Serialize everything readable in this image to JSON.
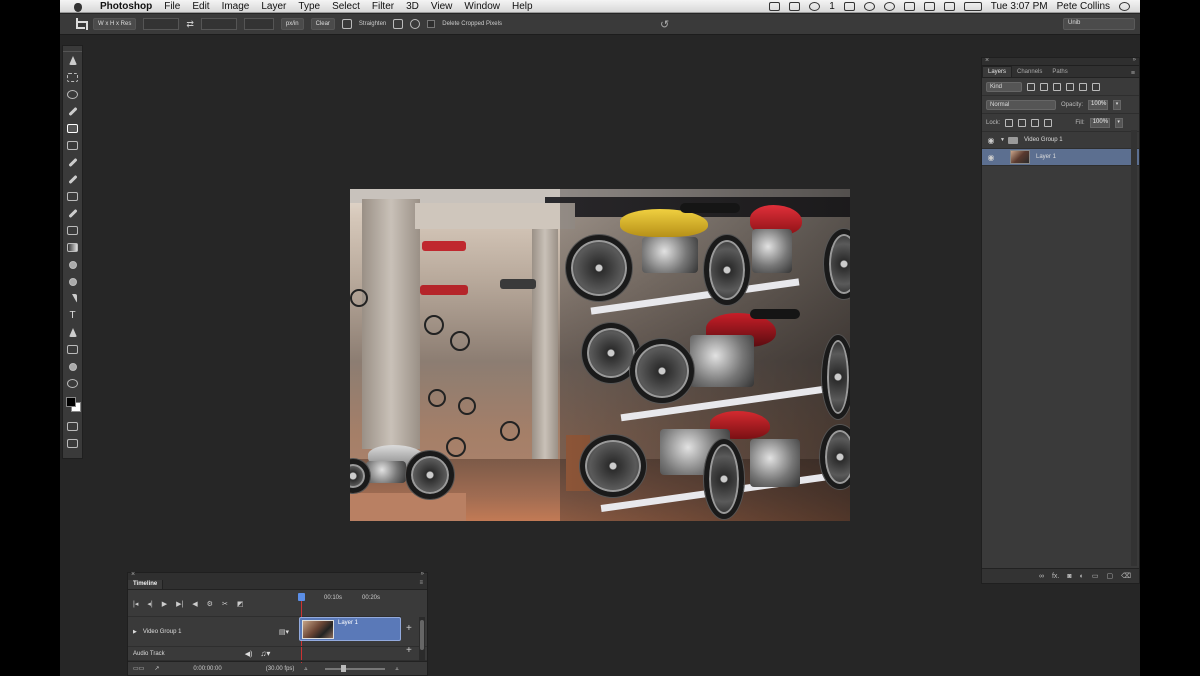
{
  "menubar": {
    "app": "Photoshop",
    "items": [
      "File",
      "Edit",
      "Image",
      "Layer",
      "Type",
      "Select",
      "Filter",
      "3D",
      "View",
      "Window",
      "Help"
    ],
    "status_number": "1",
    "clock": "Tue 3:07 PM",
    "user": "Pete Collins"
  },
  "options": {
    "ratio_preset": "W x H x Res",
    "units": "px/in",
    "clear_label": "Clear",
    "straighten_label": "Straighten",
    "delete_cropped_label": "Delete Cropped Pixels",
    "preset_dropdown": "Unib"
  },
  "layers_panel": {
    "tabs": [
      "Layers",
      "Channels",
      "Paths"
    ],
    "filter_kind": "Kind",
    "blend_mode": "Normal",
    "opacity_label": "Opacity:",
    "opacity_value": "100%",
    "lock_label": "Lock:",
    "fill_label": "Fill:",
    "fill_value": "100%",
    "group_name": "Video Group 1",
    "layer_name": "Layer 1",
    "footer_fx": "fx."
  },
  "timeline": {
    "tab": "Timeline",
    "ruler_ticks": [
      "00:10s",
      "00:20s"
    ],
    "video_group": "Video Group 1",
    "clip_label": "Layer 1",
    "audio_track": "Audio Track",
    "timecode": "0:00:00:00",
    "fps": "(30.00 fps)"
  }
}
